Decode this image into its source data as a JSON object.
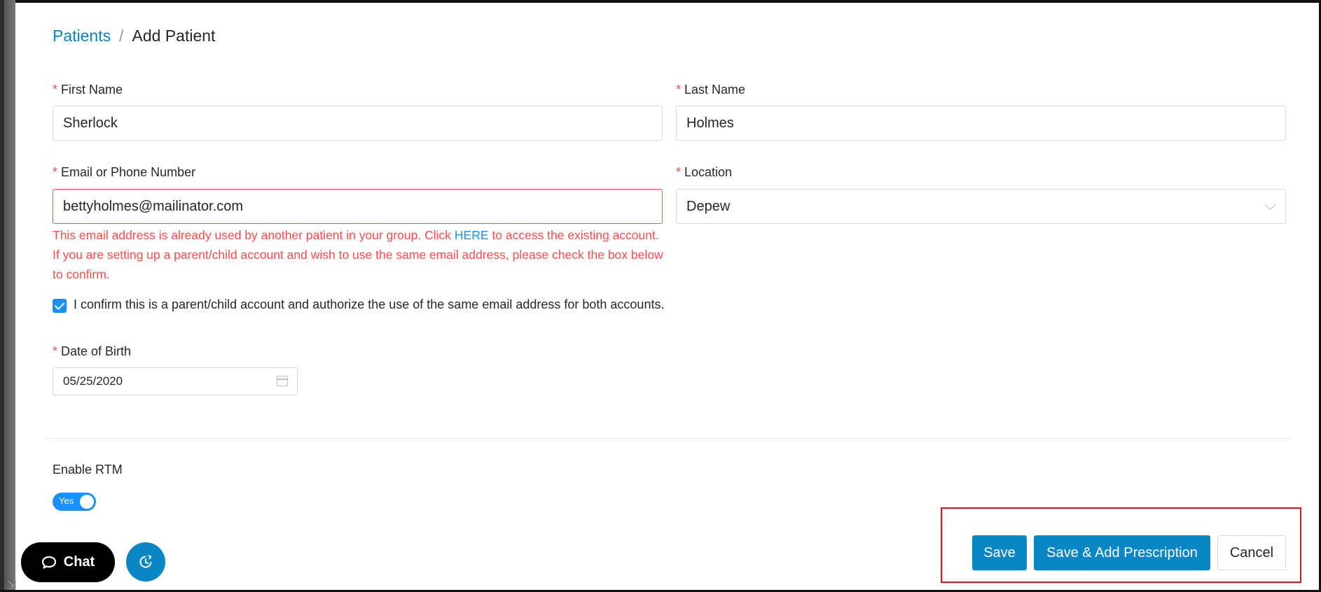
{
  "breadcrumb": {
    "parent": "Patients",
    "separator": "/",
    "current": "Add Patient"
  },
  "form": {
    "first_name": {
      "label": "First Name",
      "value": "Sherlock"
    },
    "last_name": {
      "label": "Last Name",
      "value": "Holmes"
    },
    "email": {
      "label": "Email or Phone Number",
      "value": "bettyholmes@mailinator.com",
      "error_part1": "This email address is already used by another patient in your group. Click ",
      "error_link": "HERE",
      "error_part2": " to access the existing account. If you are setting up a parent/child account and wish to use the same email address, please check the box below to confirm."
    },
    "location": {
      "label": "Location",
      "value": "Depew"
    },
    "confirm_checkbox": {
      "label": "I confirm this is a parent/child account and authorize the use of the same email address for both accounts.",
      "checked": true
    },
    "dob": {
      "label": "Date of Birth",
      "value": "05/25/2020"
    },
    "rtm": {
      "label": "Enable RTM",
      "toggle_text": "Yes",
      "enabled": true
    },
    "required_marker": "*"
  },
  "actions": {
    "save": "Save",
    "save_add": "Save & Add Prescription",
    "cancel": "Cancel"
  },
  "widgets": {
    "chat": "Chat"
  },
  "colors": {
    "primary": "#0b86c4",
    "error": "#ff4d4f",
    "link": "#1890ff",
    "highlight": "#e0141e"
  }
}
